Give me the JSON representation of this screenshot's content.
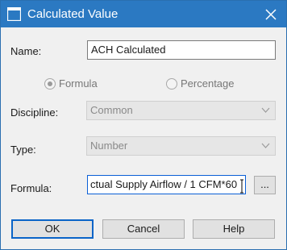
{
  "window": {
    "title": "Calculated Value",
    "icons": {
      "app": "dialog-app-icon",
      "close": "close-icon"
    }
  },
  "form": {
    "name_label": "Name:",
    "name_value": "ACH Calculated",
    "radio_formula_label": "Formula",
    "radio_percentage_label": "Percentage",
    "radio_selected": "Formula",
    "discipline_label": "Discipline:",
    "discipline_value": "Common",
    "type_label": "Type:",
    "type_value": "Number",
    "formula_label": "Formula:",
    "formula_value": "ctual Supply Airflow / 1 CFM*60",
    "browse_label": "..."
  },
  "buttons": {
    "ok": "OK",
    "cancel": "Cancel",
    "help": "Help"
  },
  "colors": {
    "titlebar": "#2b79c2",
    "focus_border": "#0a5fd6"
  }
}
